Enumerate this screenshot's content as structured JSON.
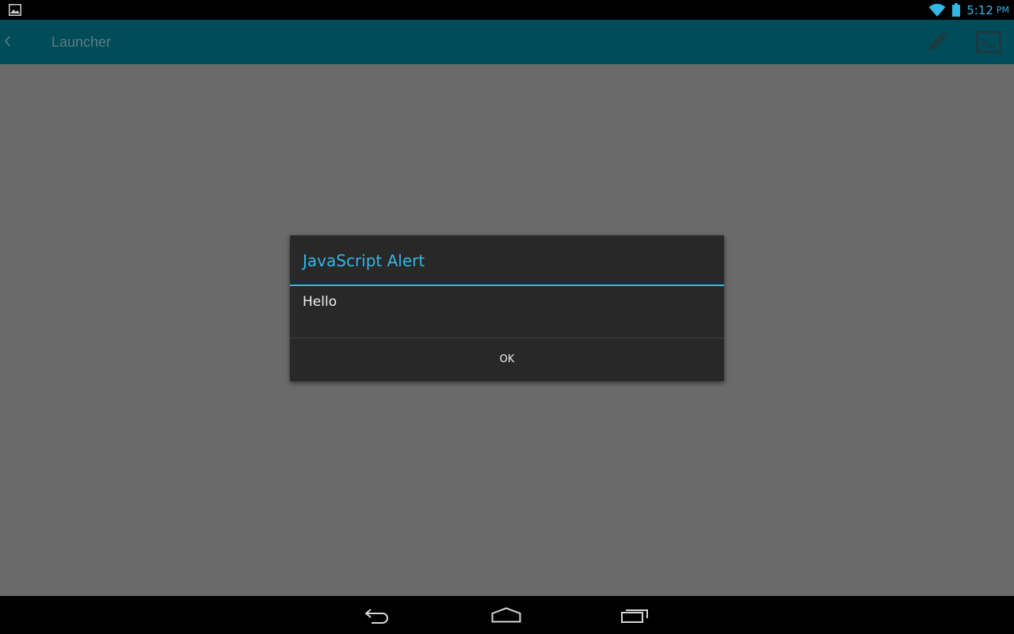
{
  "status_bar": {
    "notification_icon": "image-icon",
    "wifi_icon": "wifi-icon",
    "battery_icon": "battery-icon",
    "time": "5:12",
    "ampm": "PM",
    "accent_color": "#33b5e5"
  },
  "action_bar": {
    "title": "Launcher",
    "back_icon": "chevron-left-icon",
    "actions": [
      "pencil-icon",
      "terminal-icon"
    ],
    "background_color": "#004c59"
  },
  "dialog": {
    "title": "JavaScript Alert",
    "message": "Hello",
    "ok_label": "OK",
    "title_color": "#33b5e5",
    "background_color": "#282828"
  },
  "nav_bar": {
    "buttons": [
      "back-icon",
      "home-icon",
      "recents-icon"
    ]
  }
}
